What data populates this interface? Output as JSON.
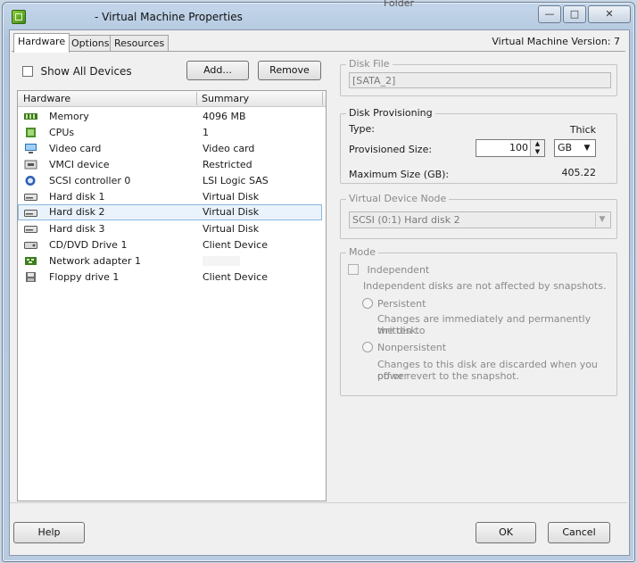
{
  "window": {
    "title": "- Virtual Machine Properties",
    "background_fragment": "Folder",
    "controls": {
      "minimize": "—",
      "maximize": "□",
      "close": "✕"
    }
  },
  "tabs": [
    {
      "label": "Hardware",
      "active": true
    },
    {
      "label": "Options",
      "active": false
    },
    {
      "label": "Resources",
      "active": false
    }
  ],
  "version_label": "Virtual Machine Version: 7",
  "hardware_panel": {
    "show_all_devices_label": "Show All Devices",
    "show_all_devices_checked": false,
    "add_label": "Add...",
    "remove_label": "Remove",
    "columns": [
      "Hardware",
      "Summary"
    ],
    "rows": [
      {
        "icon": "memory-icon",
        "name": "Memory",
        "summary": "4096 MB"
      },
      {
        "icon": "cpu-icon",
        "name": "CPUs",
        "summary": "1"
      },
      {
        "icon": "monitor-icon",
        "name": "Video card",
        "summary": "Video card"
      },
      {
        "icon": "vmci-icon",
        "name": "VMCI device",
        "summary": "Restricted"
      },
      {
        "icon": "scsi-controller-icon",
        "name": "SCSI controller 0",
        "summary": "LSI Logic SAS"
      },
      {
        "icon": "hard-disk-icon",
        "name": "Hard disk 1",
        "summary": "Virtual Disk"
      },
      {
        "icon": "hard-disk-icon",
        "name": "Hard disk 2",
        "summary": "Virtual Disk",
        "selected": true
      },
      {
        "icon": "hard-disk-icon",
        "name": "Hard disk 3",
        "summary": "Virtual Disk"
      },
      {
        "icon": "cd-dvd-icon",
        "name": "CD/DVD Drive 1",
        "summary": "Client Device"
      },
      {
        "icon": "network-adapter-icon",
        "name": "Network adapter 1",
        "summary": ""
      },
      {
        "icon": "floppy-icon",
        "name": "Floppy drive 1",
        "summary": "Client Device"
      }
    ]
  },
  "disk_file": {
    "title": "Disk File",
    "value": "[SATA_2]"
  },
  "disk_provisioning": {
    "title": "Disk Provisioning",
    "type_label": "Type:",
    "type_value": "Thick",
    "provisioned_label": "Provisioned Size:",
    "provisioned_value": "100",
    "unit": "GB",
    "max_label": "Maximum Size (GB):",
    "max_value": "405.22"
  },
  "virtual_device_node": {
    "title": "Virtual Device Node",
    "value": "SCSI (0:1) Hard disk 2"
  },
  "mode": {
    "title": "Mode",
    "independent_label": "Independent",
    "independent_desc": "Independent disks are not affected by snapshots.",
    "persistent_label": "Persistent",
    "persistent_desc_1": "Changes are immediately and permanently written to",
    "persistent_desc_2": "the disk.",
    "nonpersistent_label": "Nonpersistent",
    "nonpersistent_desc_1": "Changes to this disk are discarded when you power",
    "nonpersistent_desc_2": "off or revert to the snapshot."
  },
  "footer": {
    "help_label": "Help",
    "ok_label": "OK",
    "cancel_label": "Cancel"
  }
}
